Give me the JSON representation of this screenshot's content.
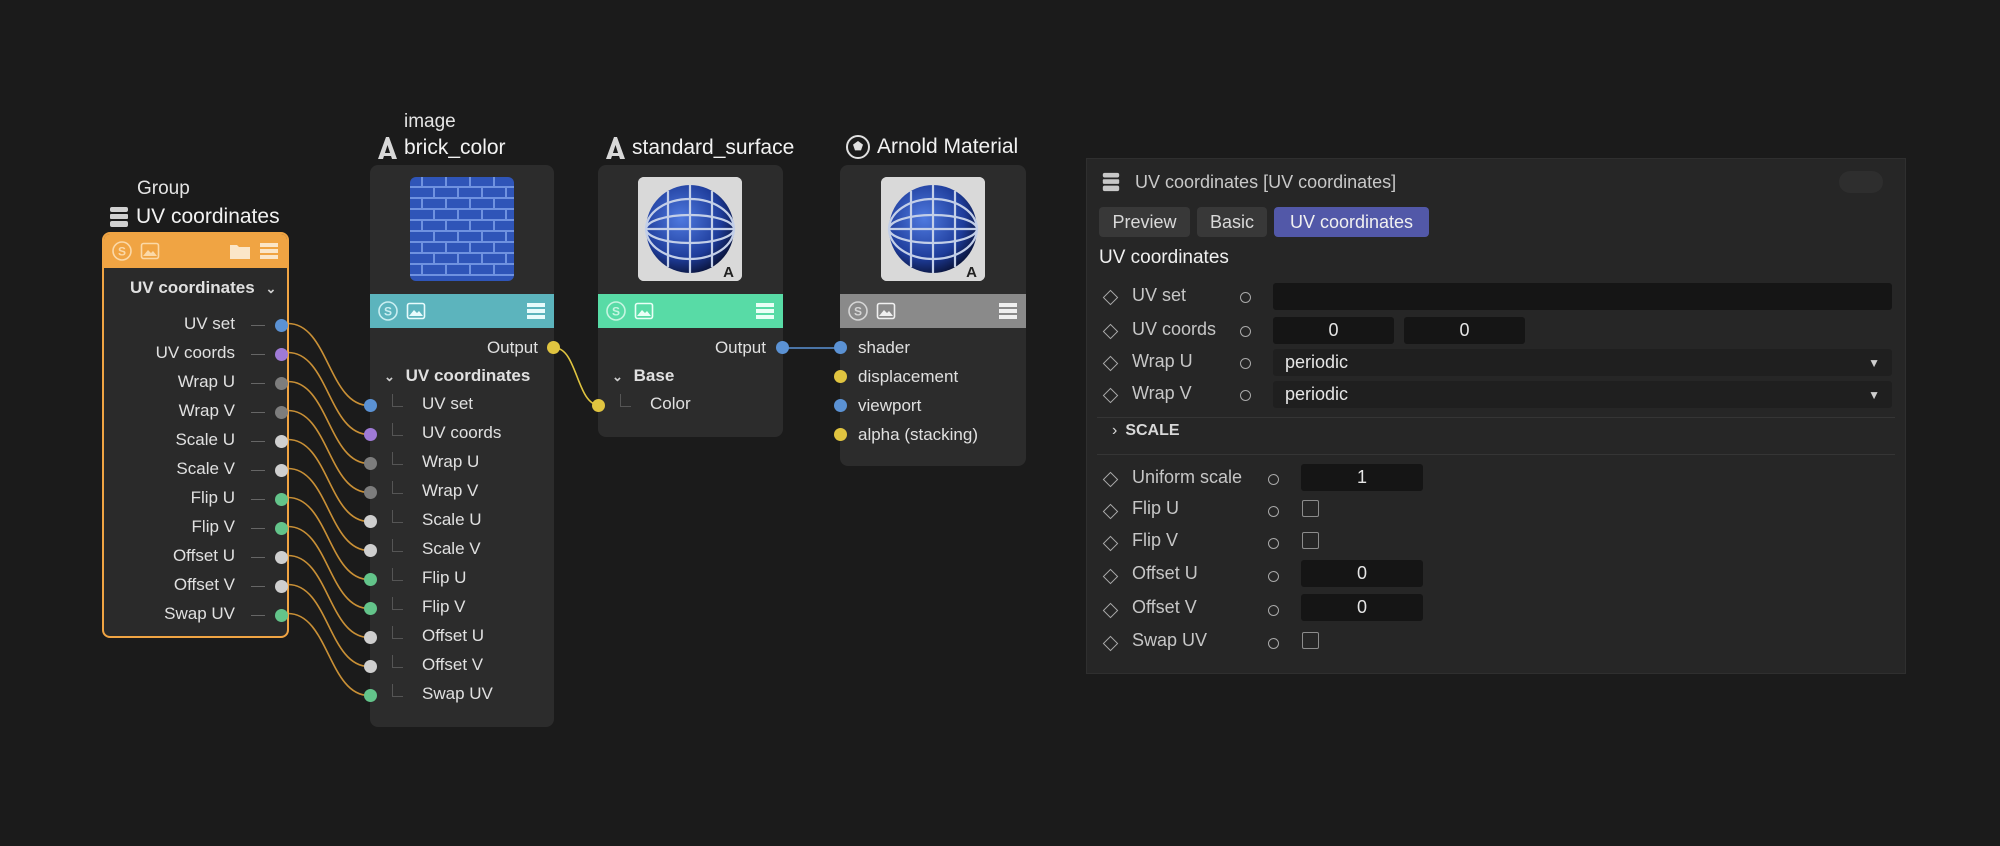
{
  "colors": {
    "background": "#1b1b1b",
    "group_accent": "#f0a443",
    "image_bar": "#5cb4bd",
    "surface_bar": "#58dba6",
    "material_bar": "#8a8a8a",
    "port_blue": "#5b92d4",
    "port_purple": "#9f7ad6",
    "port_gray": "#7d7d7d",
    "port_white": "#cfcfcf",
    "port_green": "#63c48a",
    "port_yellow": "#e0c440",
    "wire_orange": "#c99036",
    "tab_active": "#5258a8"
  },
  "group_node": {
    "subtitle": "Group",
    "title": "UV coordinates",
    "section_label": "UV coordinates",
    "ports": [
      "UV set",
      "UV coords",
      "Wrap U",
      "Wrap V",
      "Scale U",
      "Scale V",
      "Flip U",
      "Flip V",
      "Offset U",
      "Offset V",
      "Swap UV"
    ]
  },
  "image_node": {
    "subtitle": "image",
    "title": "brick_color",
    "output_label": "Output",
    "section_label": "UV coordinates",
    "ports": [
      "UV set",
      "UV coords",
      "Wrap U",
      "Wrap V",
      "Scale U",
      "Scale V",
      "Flip U",
      "Flip V",
      "Offset U",
      "Offset V",
      "Swap UV"
    ]
  },
  "surface_node": {
    "title": "standard_surface",
    "output_label": "Output",
    "section_label": "Base",
    "ports": [
      "Color"
    ]
  },
  "material_node": {
    "title": "Arnold Material",
    "ports": [
      "shader",
      "displacement",
      "viewport",
      "alpha (stacking)"
    ]
  },
  "panel": {
    "title": "UV coordinates [UV coordinates]",
    "tabs": [
      "Preview",
      "Basic",
      "UV coordinates"
    ],
    "active_tab": "UV coordinates",
    "section_title": "UV coordinates",
    "uv_set_label": "UV set",
    "uv_set_value": "",
    "uv_coords_label": "UV coords",
    "uv_coords_values": [
      "0",
      "0"
    ],
    "wrap_u_label": "Wrap U",
    "wrap_u_value": "periodic",
    "wrap_v_label": "Wrap V",
    "wrap_v_value": "periodic",
    "scale_section": "SCALE",
    "uniform_scale_label": "Uniform scale",
    "uniform_scale_value": "1",
    "flip_u_label": "Flip U",
    "flip_u_checked": false,
    "flip_v_label": "Flip V",
    "flip_v_checked": false,
    "offset_u_label": "Offset U",
    "offset_u_value": "0",
    "offset_v_label": "Offset V",
    "offset_v_value": "0",
    "swap_uv_label": "Swap UV",
    "swap_uv_checked": false
  }
}
